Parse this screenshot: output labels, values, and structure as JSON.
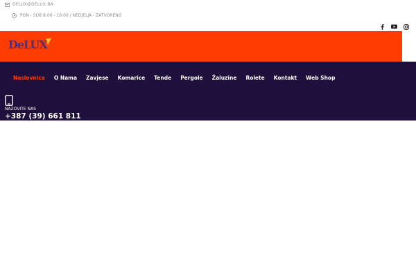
{
  "topbar": {
    "email": "DELUX@DELUX.BA",
    "hours": "PON - SUB 8:00 - 16:00 / NEDJELJA - ZATVORENO"
  },
  "social": [
    "facebook-icon",
    "youtube-icon",
    "instagram-icon"
  ],
  "brand": {
    "logo_text": "DeLUX",
    "primary_color": "#ff3d00",
    "dark_color": "#1f0f3d"
  },
  "nav": {
    "items": [
      {
        "label": "Naslovnica",
        "active": true
      },
      {
        "label": "O Nama"
      },
      {
        "label": "Zavjese"
      },
      {
        "label": "Komarice"
      },
      {
        "label": "Tende"
      },
      {
        "label": "Pergole"
      },
      {
        "label": "Žaluzine"
      },
      {
        "label": "Rolete"
      },
      {
        "label": "Kontakt"
      },
      {
        "label": "Web Shop"
      }
    ]
  },
  "call": {
    "label": "NAZOVITE NAS",
    "number": "+387 (39) 661 811"
  }
}
